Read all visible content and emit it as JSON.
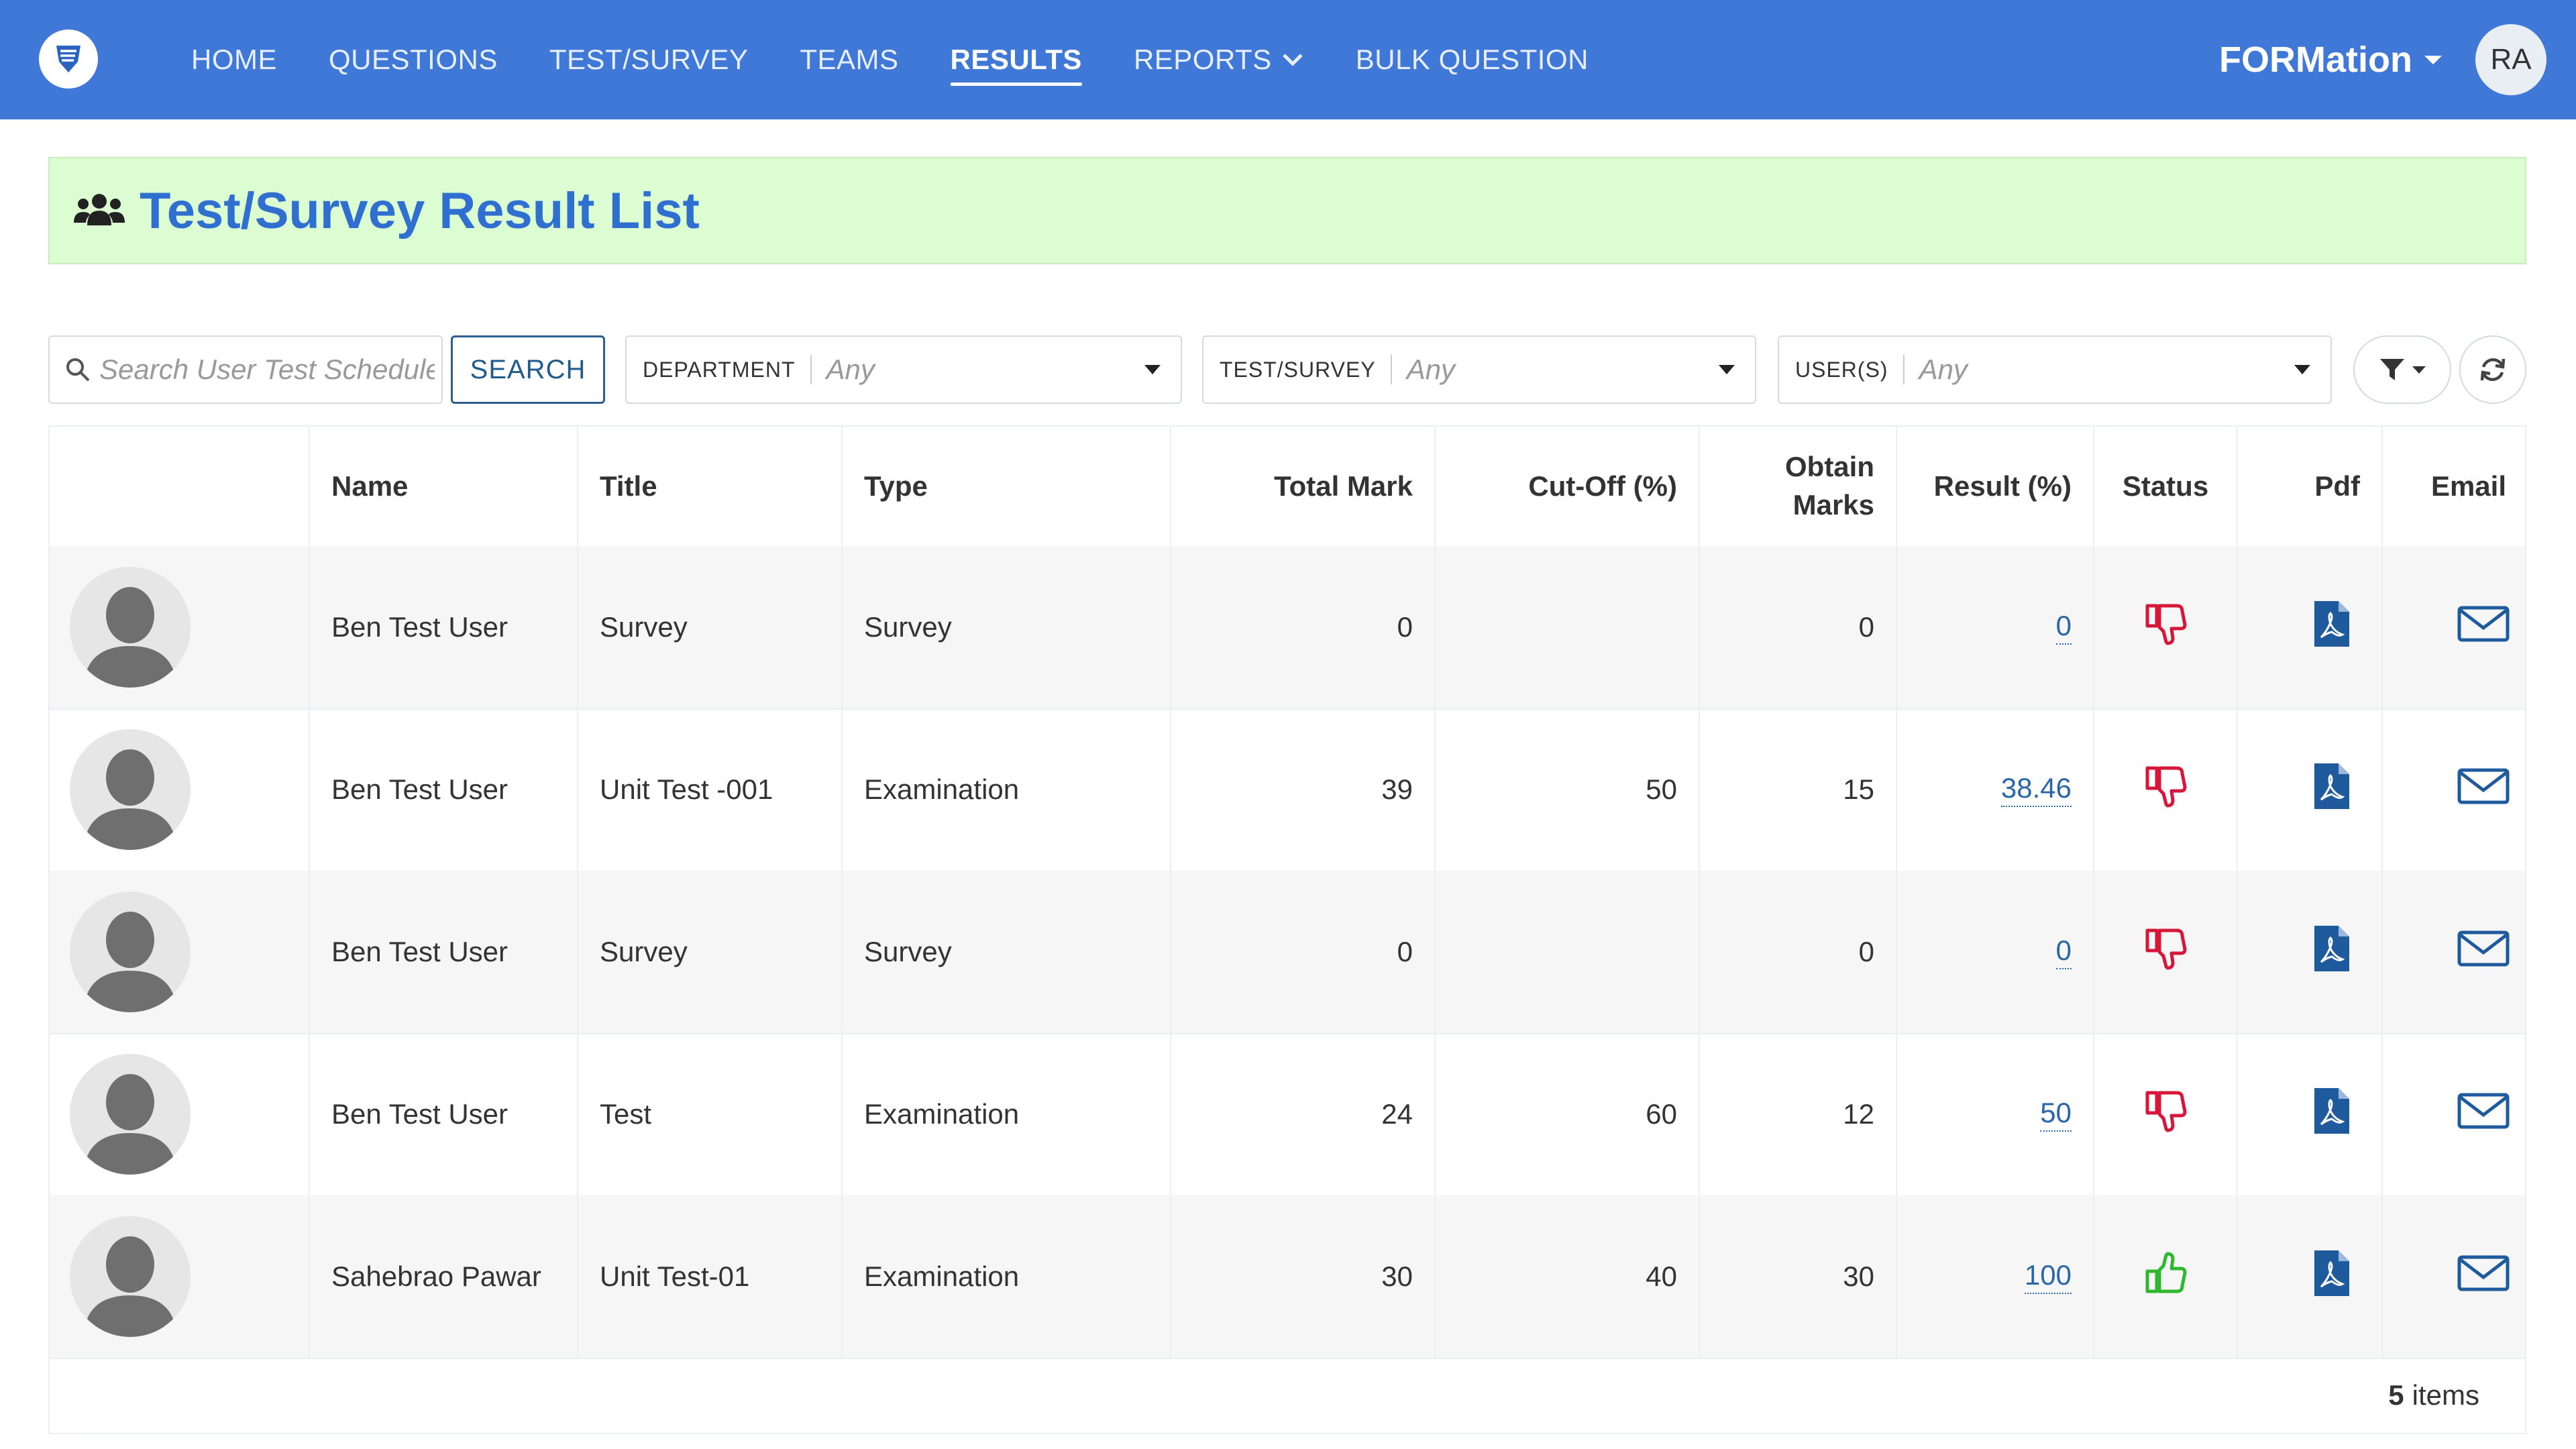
{
  "nav": {
    "items": [
      {
        "label": "HOME"
      },
      {
        "label": "QUESTIONS"
      },
      {
        "label": "TEST/SURVEY"
      },
      {
        "label": "TEAMS"
      },
      {
        "label": "RESULTS",
        "active": true
      },
      {
        "label": "REPORTS",
        "has_dropdown": true
      },
      {
        "label": "BULK QUESTION"
      }
    ],
    "brand": "FORMation",
    "user_initials": "RA",
    "bar_color": "#3f78d6"
  },
  "page": {
    "title": "Test/Survey Result List",
    "title_icon": "users-icon"
  },
  "filters": {
    "search_placeholder": "Search User Test Schedule",
    "search_button": "SEARCH",
    "department_label": "DEPARTMENT",
    "department_value": "Any",
    "test_label": "TEST/SURVEY",
    "test_value": "Any",
    "users_label": "USER(S)",
    "users_value": "Any"
  },
  "table": {
    "columns": [
      "",
      "Name",
      "Title",
      "Type",
      "Total Mark",
      "Cut-Off (%)",
      "Obtain Marks",
      "Result (%)",
      "Status",
      "Pdf",
      "Email"
    ],
    "rows": [
      {
        "name": "Ben Test User",
        "title": "Survey",
        "type": "Survey",
        "total": "0",
        "cutoff": "",
        "obtain": "0",
        "result": "0",
        "status": "fail"
      },
      {
        "name": "Ben Test User",
        "title": "Unit Test -001",
        "type": "Examination",
        "total": "39",
        "cutoff": "50",
        "obtain": "15",
        "result": "38.46",
        "status": "fail"
      },
      {
        "name": "Ben Test User",
        "title": "Survey",
        "type": "Survey",
        "total": "0",
        "cutoff": "",
        "obtain": "0",
        "result": "0",
        "status": "fail"
      },
      {
        "name": "Ben Test User",
        "title": "Test",
        "type": "Examination",
        "total": "24",
        "cutoff": "60",
        "obtain": "12",
        "result": "50",
        "status": "fail"
      },
      {
        "name": "Sahebrao Pawar",
        "title": "Unit Test-01",
        "type": "Examination",
        "total": "30",
        "cutoff": "40",
        "obtain": "30",
        "result": "100",
        "status": "pass"
      }
    ],
    "footer_count": "5",
    "footer_label": "items"
  },
  "colors": {
    "fail": "#d6173a",
    "pass": "#2fb82f",
    "pdf": "#1f5b9c",
    "email": "#1f5b9c",
    "title": "#2e6fd0",
    "title_bg": "#dcfcd2"
  }
}
